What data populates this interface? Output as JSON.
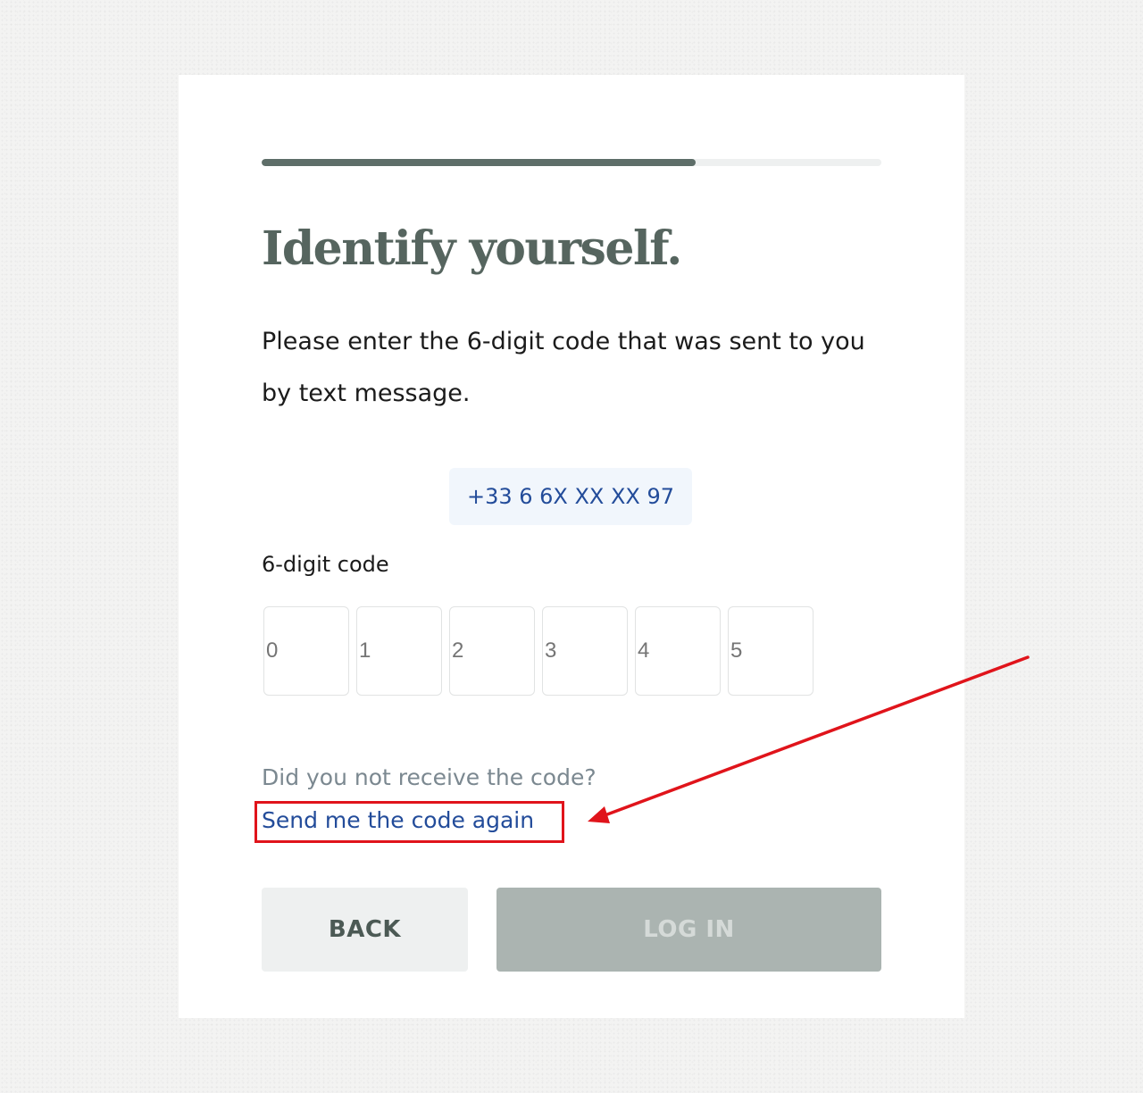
{
  "progress": {
    "fraction": 0.7
  },
  "header": {
    "title": "Identify yourself."
  },
  "instructions": {
    "text": "Please enter the 6-digit code that was sent to you by text message."
  },
  "phone": {
    "number": "+33 6 6X XX XX 97"
  },
  "code": {
    "label": "6-digit code",
    "placeholders": [
      "0",
      "1",
      "2",
      "3",
      "4",
      "5"
    ]
  },
  "resend": {
    "question": "Did you not receive the code?",
    "link_label": "Send me the code again"
  },
  "actions": {
    "back_label": "BACK",
    "login_label": "LOG IN"
  },
  "annotation": {
    "color": "#e0141b"
  }
}
